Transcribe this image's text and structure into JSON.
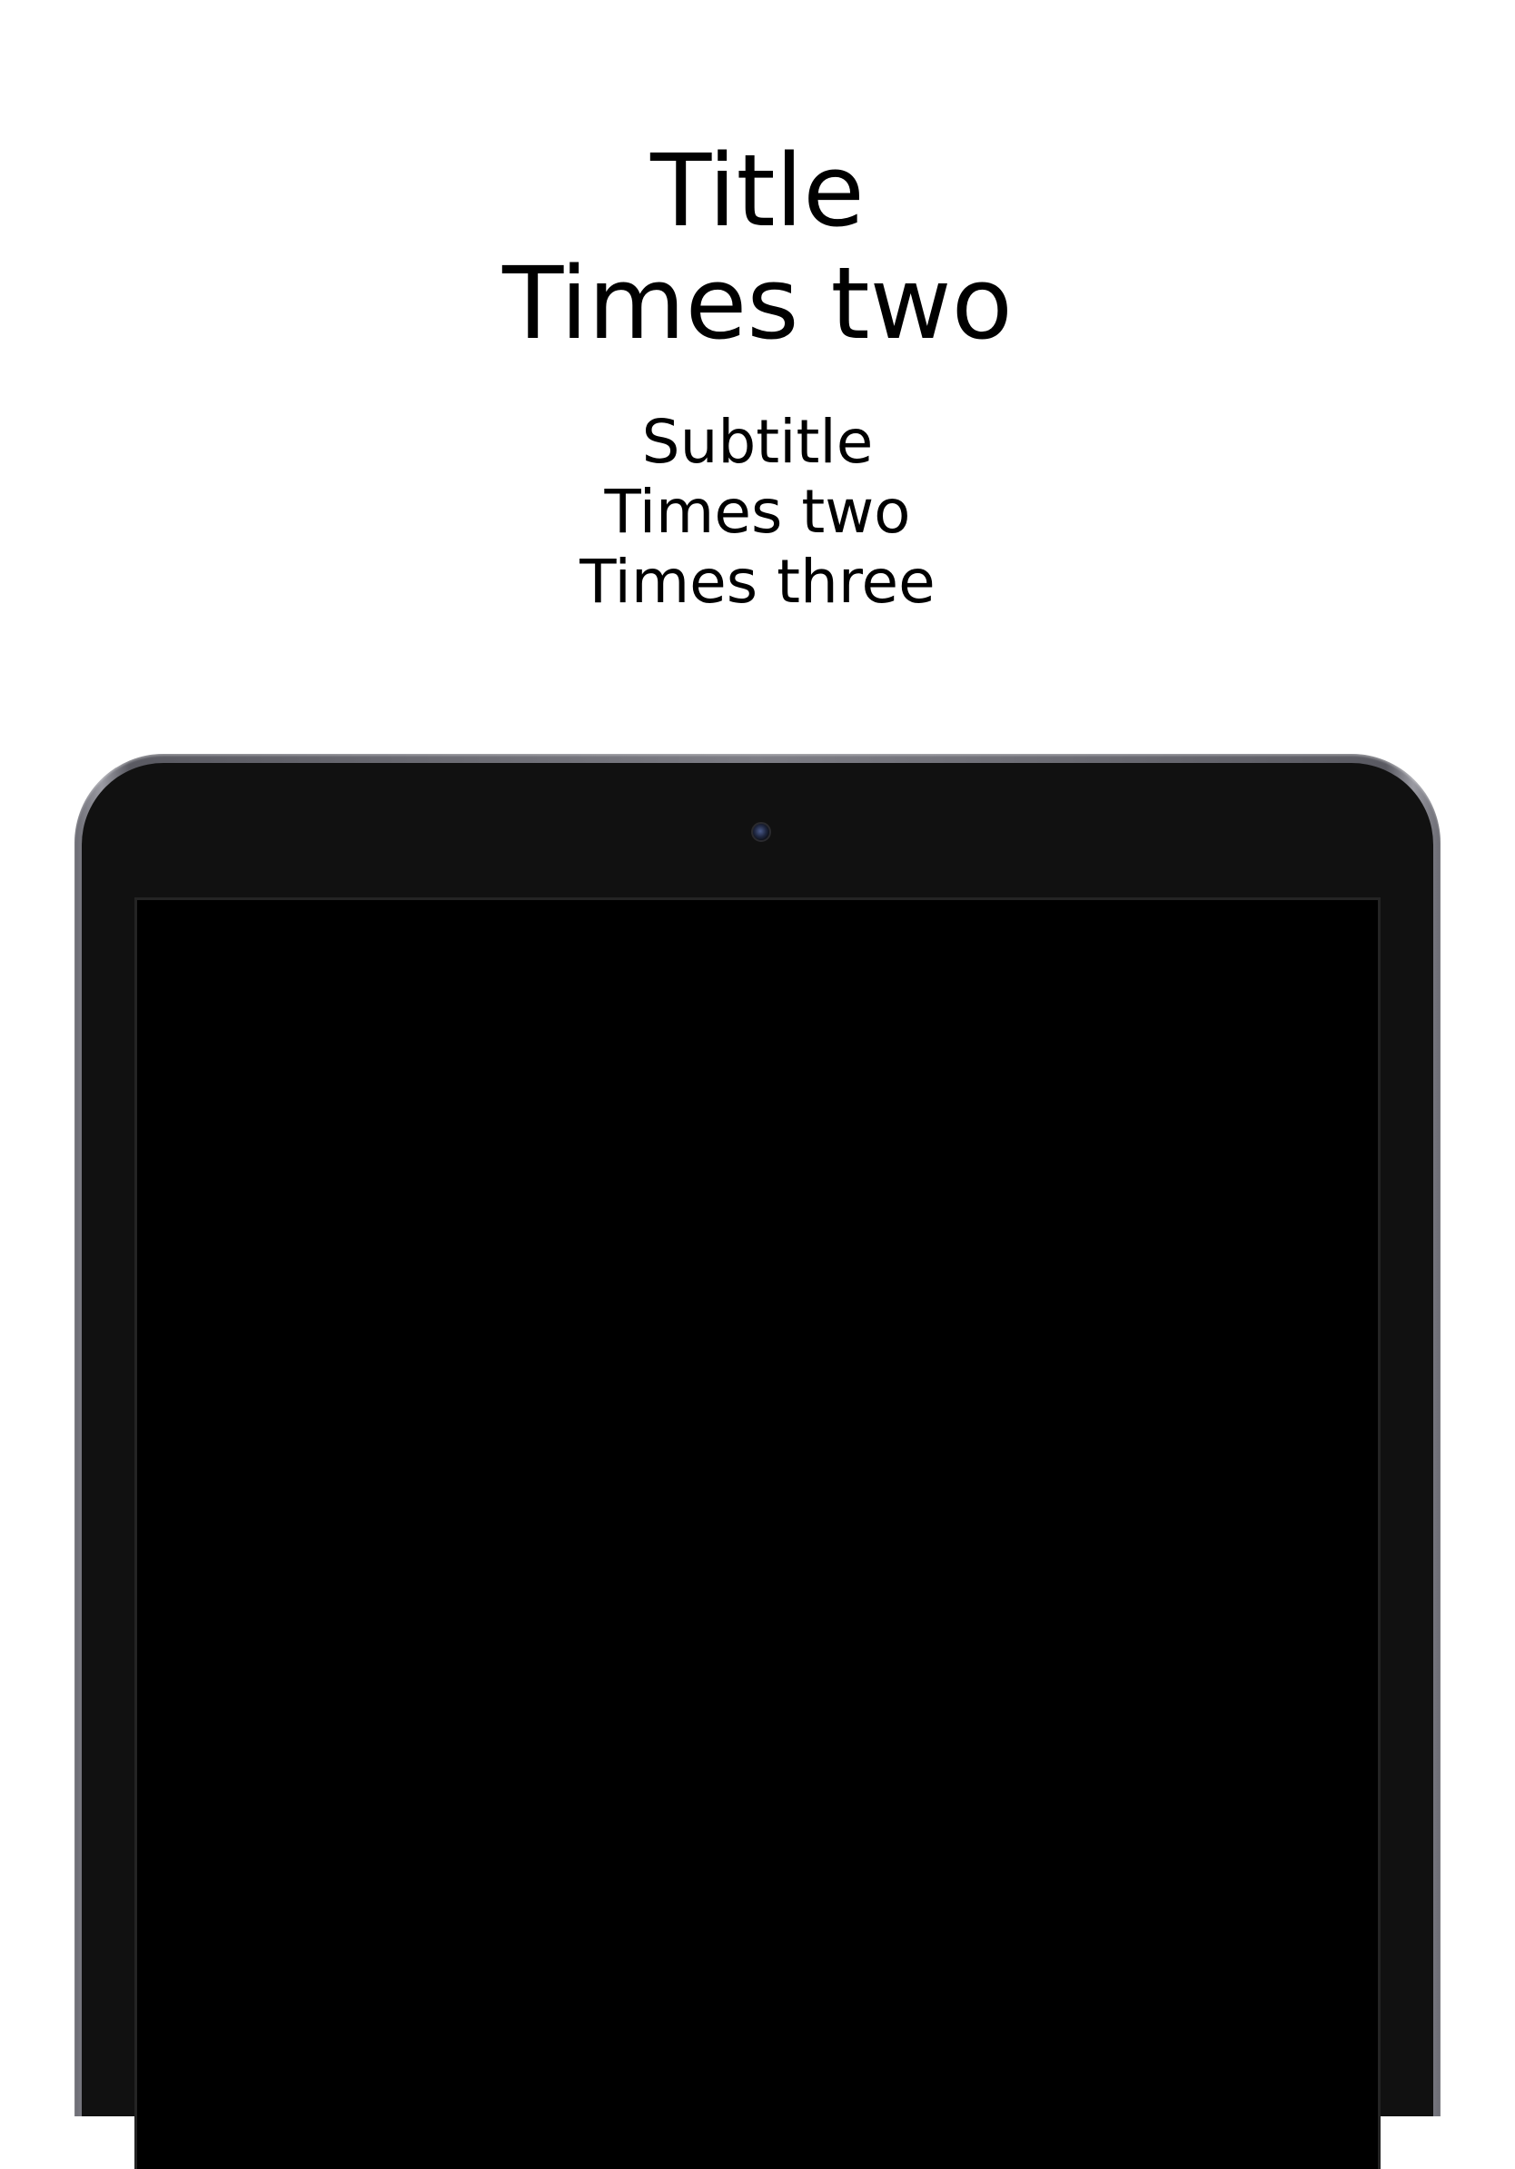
{
  "header": {
    "title_lines": [
      "Title",
      "Times two"
    ],
    "subtitle_lines": [
      "Subtitle",
      "Times two",
      "Times three"
    ]
  },
  "device": {
    "type": "tablet",
    "frame_color": "#7d7d85",
    "bezel_color": "#111111",
    "screen_color": "#000000",
    "camera_icon": "camera-icon"
  }
}
